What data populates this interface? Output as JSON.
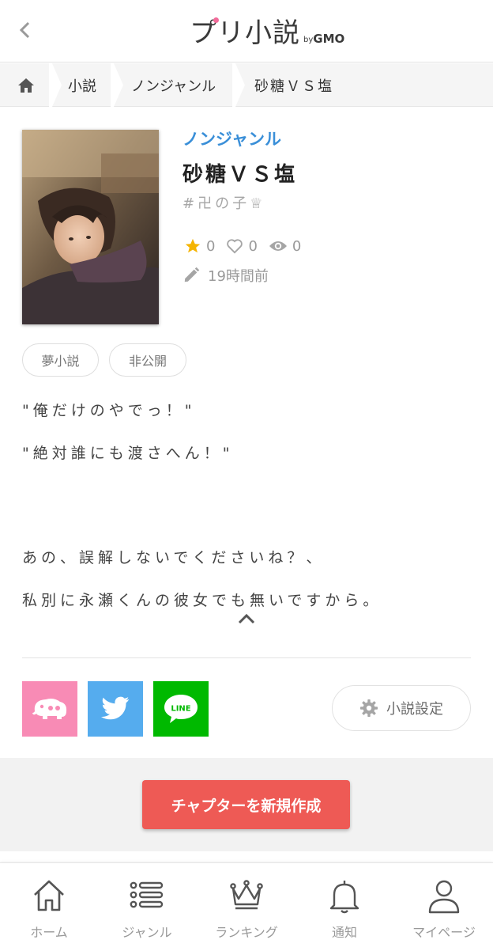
{
  "header": {
    "back_icon": "chevron-left-icon",
    "logo_main": "プリ小説",
    "logo_by": "by",
    "logo_gmo": "GMO"
  },
  "breadcrumb": {
    "home_icon": "home-icon",
    "items": [
      "小説",
      "ノンジャンル",
      "砂糖ＶＳ塩"
    ]
  },
  "novel": {
    "genre": "ノンジャンル",
    "title": "砂糖ＶＳ塩",
    "hashtag": "#卍の子♕",
    "stars": "0",
    "likes": "0",
    "views": "0",
    "updated": "19時間前",
    "tags": [
      "夢小説",
      "非公開"
    ],
    "description": [
      "\"俺だけのやでっ！\"",
      "\"絶対誰にも渡さへん！\"",
      "あの、誤解しないでくださいね？、",
      "私別に永瀬くんの彼女でも無いですから。"
    ]
  },
  "actions": {
    "share_app_icon": "elephant-icon",
    "share_twitter_icon": "twitter-icon",
    "share_line_label": "LINE",
    "settings_label": "小説設定",
    "create_chapter_label": "チャプターを新規作成"
  },
  "bottom_nav": {
    "items": [
      {
        "label": "ホーム",
        "icon": "home-icon"
      },
      {
        "label": "ジャンル",
        "icon": "list-icon"
      },
      {
        "label": "ランキング",
        "icon": "crown-icon"
      },
      {
        "label": "通知",
        "icon": "bell-icon"
      },
      {
        "label": "マイページ",
        "icon": "user-icon"
      }
    ]
  },
  "colors": {
    "accent_blue": "#3a8fd8",
    "create_button": "#ee5a55",
    "star": "#f5b400",
    "share_app": "#f88bb5",
    "twitter": "#55acee",
    "line": "#00b900"
  }
}
